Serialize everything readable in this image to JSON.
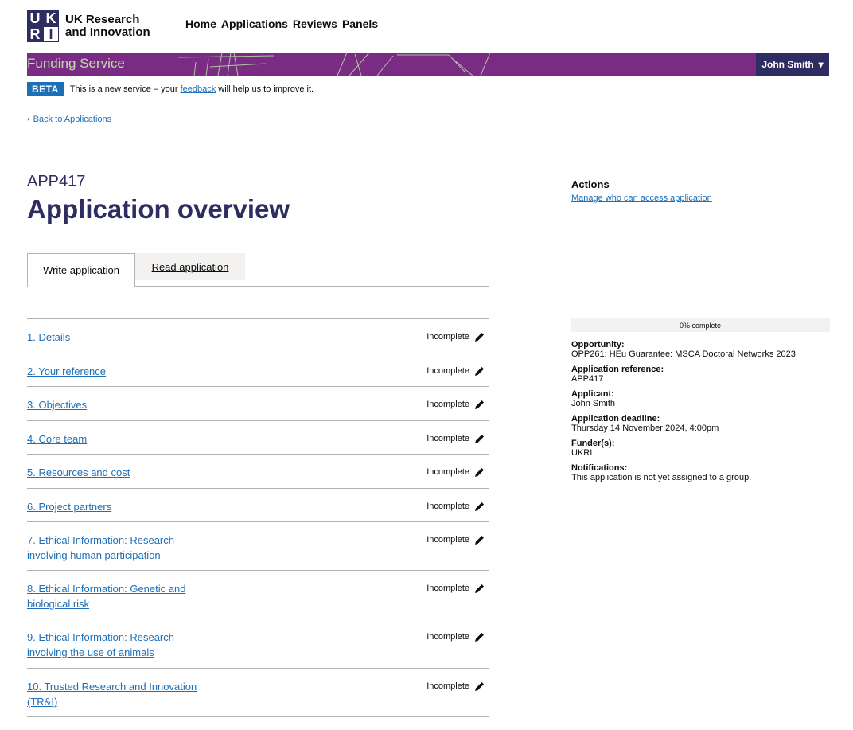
{
  "brand": {
    "logo_letters": [
      "U",
      "K",
      "R",
      "I"
    ],
    "org_line1": "UK Research",
    "org_line2": "and Innovation",
    "service_name": "Funding Service",
    "colors": {
      "purple": "#7a2b84",
      "navy": "#2e2d62",
      "link": "#1d70b8",
      "service_green": "#b9e0a7"
    }
  },
  "nav": {
    "items": [
      {
        "label": "Home"
      },
      {
        "label": "Applications"
      },
      {
        "label": "Reviews"
      },
      {
        "label": "Panels"
      }
    ]
  },
  "user": {
    "name": "John Smith",
    "menu_icon": "caret-down-icon"
  },
  "beta": {
    "tag": "BETA",
    "text_before": "This is a new service – your",
    "link": "feedback",
    "text_after": "will help us to improve it."
  },
  "back_link": {
    "label": "Back to Applications",
    "icon": "chevron-left-icon"
  },
  "page": {
    "reference": "APP417",
    "title": "Application overview"
  },
  "tabs": [
    {
      "label": "Write application",
      "active": true
    },
    {
      "label": "Read application",
      "active": false
    }
  ],
  "sections": [
    {
      "label": "1. Details",
      "status": "Incomplete"
    },
    {
      "label": "2. Your reference",
      "status": "Incomplete"
    },
    {
      "label": "3. Objectives",
      "status": "Incomplete"
    },
    {
      "label": "4. Core team",
      "status": "Incomplete"
    },
    {
      "label": "5. Resources and cost",
      "status": "Incomplete"
    },
    {
      "label": "6. Project partners",
      "status": "Incomplete"
    },
    {
      "label": "7. Ethical Information: Research involving human participation",
      "status": "Incomplete"
    },
    {
      "label": "8. Ethical Information: Genetic and biological risk",
      "status": "Incomplete"
    },
    {
      "label": "9. Ethical Information: Research involving the use of animals",
      "status": "Incomplete"
    },
    {
      "label": "10. Trusted Research and Innovation (TR&I)",
      "status": "Incomplete"
    }
  ],
  "actions": {
    "title": "Actions",
    "manage_link": "Manage who can access application"
  },
  "progress": {
    "label": "0% complete",
    "percent": 0
  },
  "details": [
    {
      "label": "Opportunity:",
      "value": "OPP261: HEu Guarantee: MSCA Doctoral Networks 2023"
    },
    {
      "label": "Application reference:",
      "value": "APP417"
    },
    {
      "label": "Applicant:",
      "value": "John Smith"
    },
    {
      "label": "Application deadline:",
      "value": "Thursday 14 November 2024, 4:00pm"
    },
    {
      "label": "Funder(s):",
      "value": "UKRI"
    },
    {
      "label": "Notifications:",
      "value": "This application is not yet assigned to a group."
    }
  ]
}
